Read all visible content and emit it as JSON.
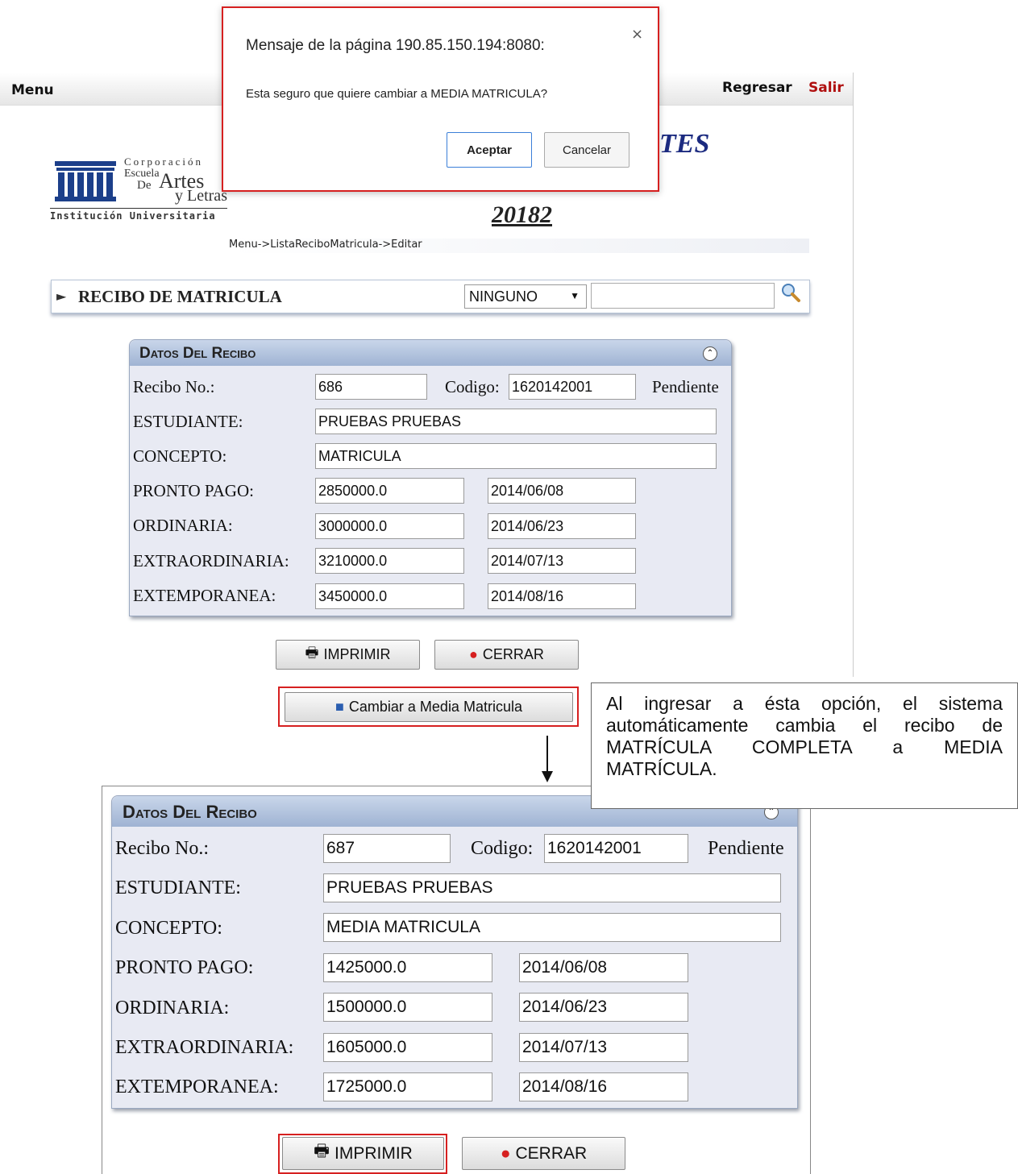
{
  "topbar": {
    "menu": "Menu",
    "regresar": "Regresar",
    "salir": "Salir"
  },
  "logo": {
    "corp": "Corporación",
    "escuela": "Escuela",
    "de": "De",
    "artes": "Artes",
    "letras": "y Letras",
    "inst": "Institución Universitaria"
  },
  "header": {
    "title_fragment": "TES",
    "period": "20182",
    "breadcrumb": "Menu->ListaReciboMatricula->Editar"
  },
  "recbar": {
    "title": "RECIBO DE MATRICULA",
    "select_value": "NINGUNO",
    "search_value": ""
  },
  "dialog": {
    "title": "Mensaje de la página 190.85.150.194:8080:",
    "close": "×",
    "message": "Esta seguro que quiere cambiar a MEDIA MATRICULA?",
    "ok": "Aceptar",
    "cancel": "Cancelar"
  },
  "panel1": {
    "title": "Datos Del Recibo",
    "recibo_label": "Recibo No.:",
    "recibo": "686",
    "codigo_label": "Codigo:",
    "codigo": "1620142001",
    "estado": "Pendiente",
    "estudiante_label": "ESTUDIANTE:",
    "estudiante": "PRUEBAS PRUEBAS",
    "concepto_label": "CONCEPTO:",
    "concepto": "MATRICULA",
    "rows": [
      {
        "label": "PRONTO PAGO:",
        "valor": "2850000.0",
        "fecha": "2014/06/08"
      },
      {
        "label": "ORDINARIA:",
        "valor": "3000000.0",
        "fecha": "2014/06/23"
      },
      {
        "label": "EXTRAORDINARIA:",
        "valor": "3210000.0",
        "fecha": "2014/07/13"
      },
      {
        "label": "EXTEMPORANEA:",
        "valor": "3450000.0",
        "fecha": "2014/08/16"
      }
    ]
  },
  "buttons1": {
    "imprimir": "IMPRIMIR",
    "cerrar": "CERRAR",
    "media": "Cambiar a Media Matricula"
  },
  "note": "Al ingresar a ésta opción, el sistema automáticamente cambia el recibo de MATRÍCULA COMPLETA a MEDIA MATRÍCULA.",
  "panel2": {
    "title": "Datos Del Recibo",
    "recibo_label": "Recibo No.:",
    "recibo": "687",
    "codigo_label": "Codigo:",
    "codigo": "1620142001",
    "estado": "Pendiente",
    "estudiante_label": "ESTUDIANTE:",
    "estudiante": "PRUEBAS PRUEBAS",
    "concepto_label": "CONCEPTO:",
    "concepto": "MEDIA MATRICULA",
    "rows": [
      {
        "label": "PRONTO PAGO:",
        "valor": "1425000.0",
        "fecha": "2014/06/08"
      },
      {
        "label": "ORDINARIA:",
        "valor": "1500000.0",
        "fecha": "2014/06/23"
      },
      {
        "label": "EXTRAORDINARIA:",
        "valor": "1605000.0",
        "fecha": "2014/07/13"
      },
      {
        "label": "EXTEMPORANEA:",
        "valor": "1725000.0",
        "fecha": "2014/08/16"
      }
    ]
  },
  "buttons2": {
    "imprimir": "IMPRIMIR",
    "cerrar": "CERRAR"
  },
  "colors": {
    "accent_red": "#d62020",
    "title_blue": "#1c2b80",
    "panel_header": "#9fb3d3"
  }
}
